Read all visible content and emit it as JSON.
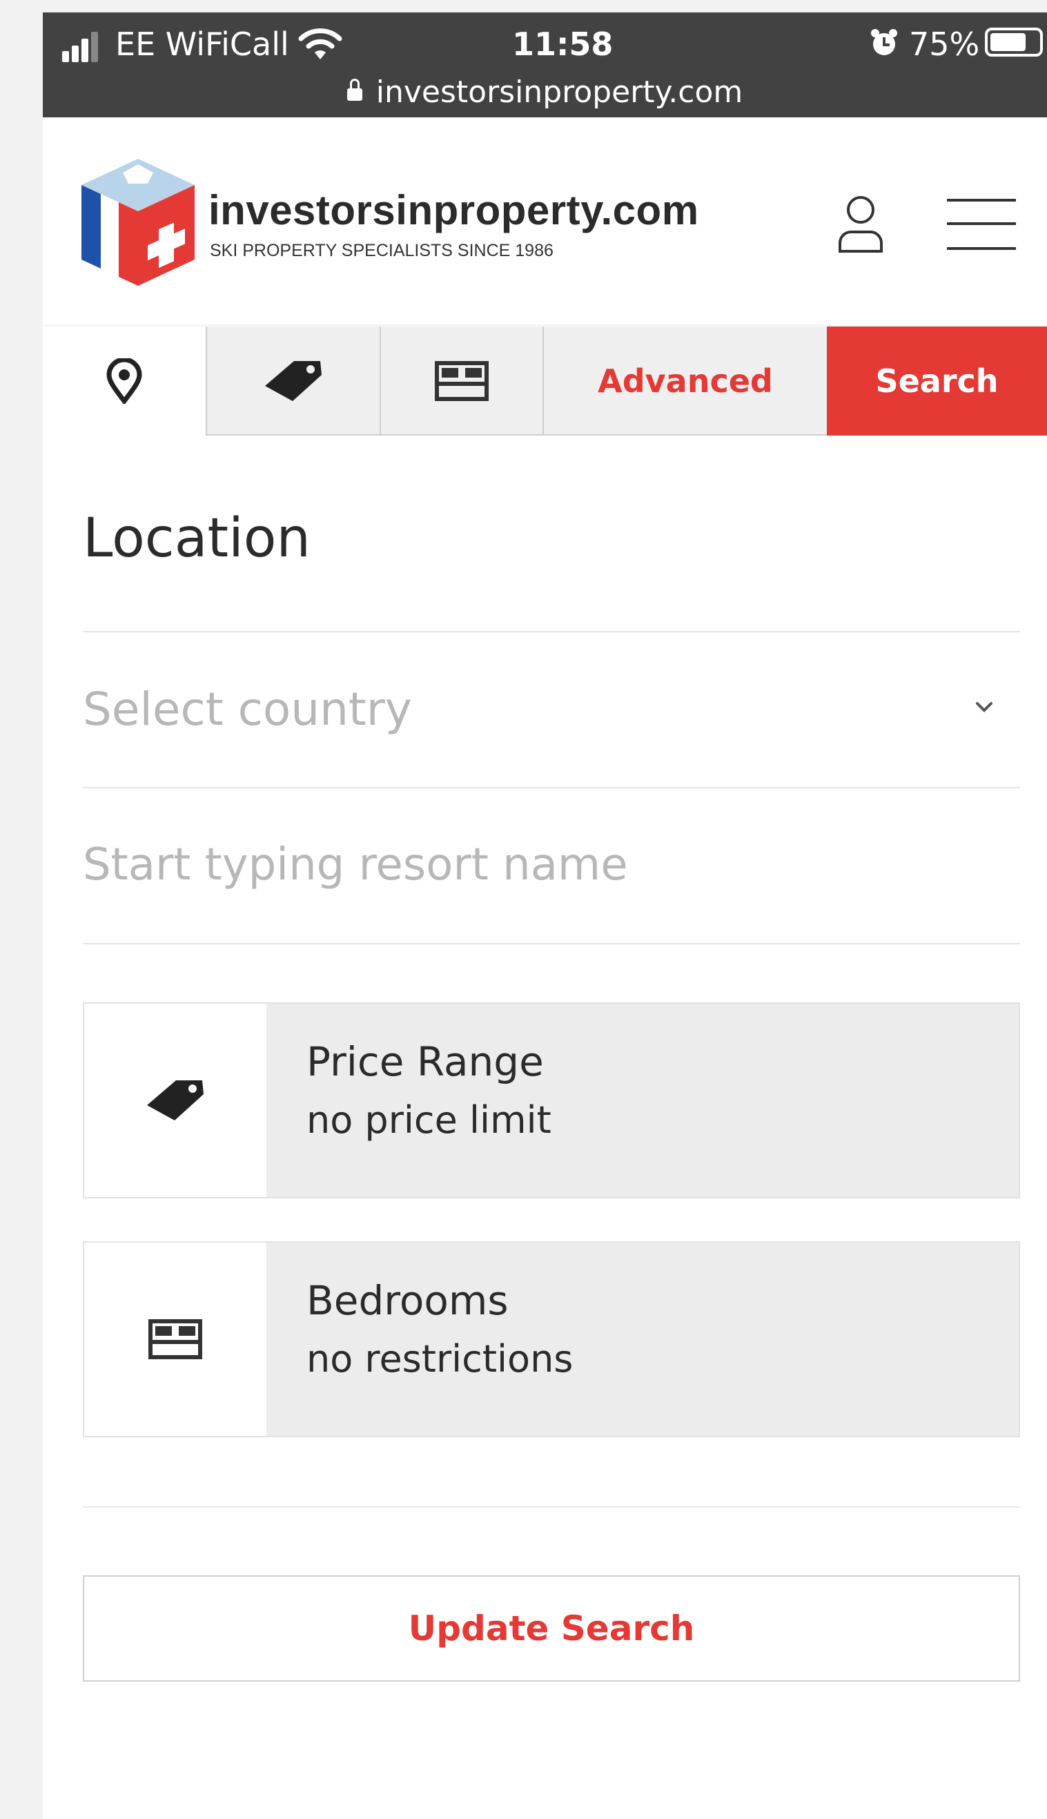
{
  "status_bar": {
    "carrier": "EE WiFiCall",
    "time": "11:58",
    "battery": "75%",
    "battery_level": 0.75,
    "url": "investorsinproperty.com"
  },
  "header": {
    "site_name": "investorsinproperty.com",
    "tagline": "SKI PROPERTY SPECIALISTS SINCE 1986"
  },
  "tabs": {
    "location_icon": "map-pin-icon",
    "price_icon": "price-tag-icon",
    "bedrooms_icon": "bed-icon",
    "advanced_label": "Advanced",
    "search_label": "Search"
  },
  "location": {
    "title": "Location",
    "country_placeholder": "Select country",
    "resort_placeholder": "Start typing resort name"
  },
  "filters": {
    "price": {
      "label": "Price Range",
      "value": "no price limit",
      "icon": "price-tag-icon"
    },
    "bedrooms": {
      "label": "Bedrooms",
      "value": "no restrictions",
      "icon": "bed-icon"
    }
  },
  "actions": {
    "update_label": "Update Search"
  },
  "colors": {
    "accent": "#e53935",
    "status_bar": "#424242",
    "text": "#2b2b2b",
    "placeholder": "#b7b7b7"
  }
}
